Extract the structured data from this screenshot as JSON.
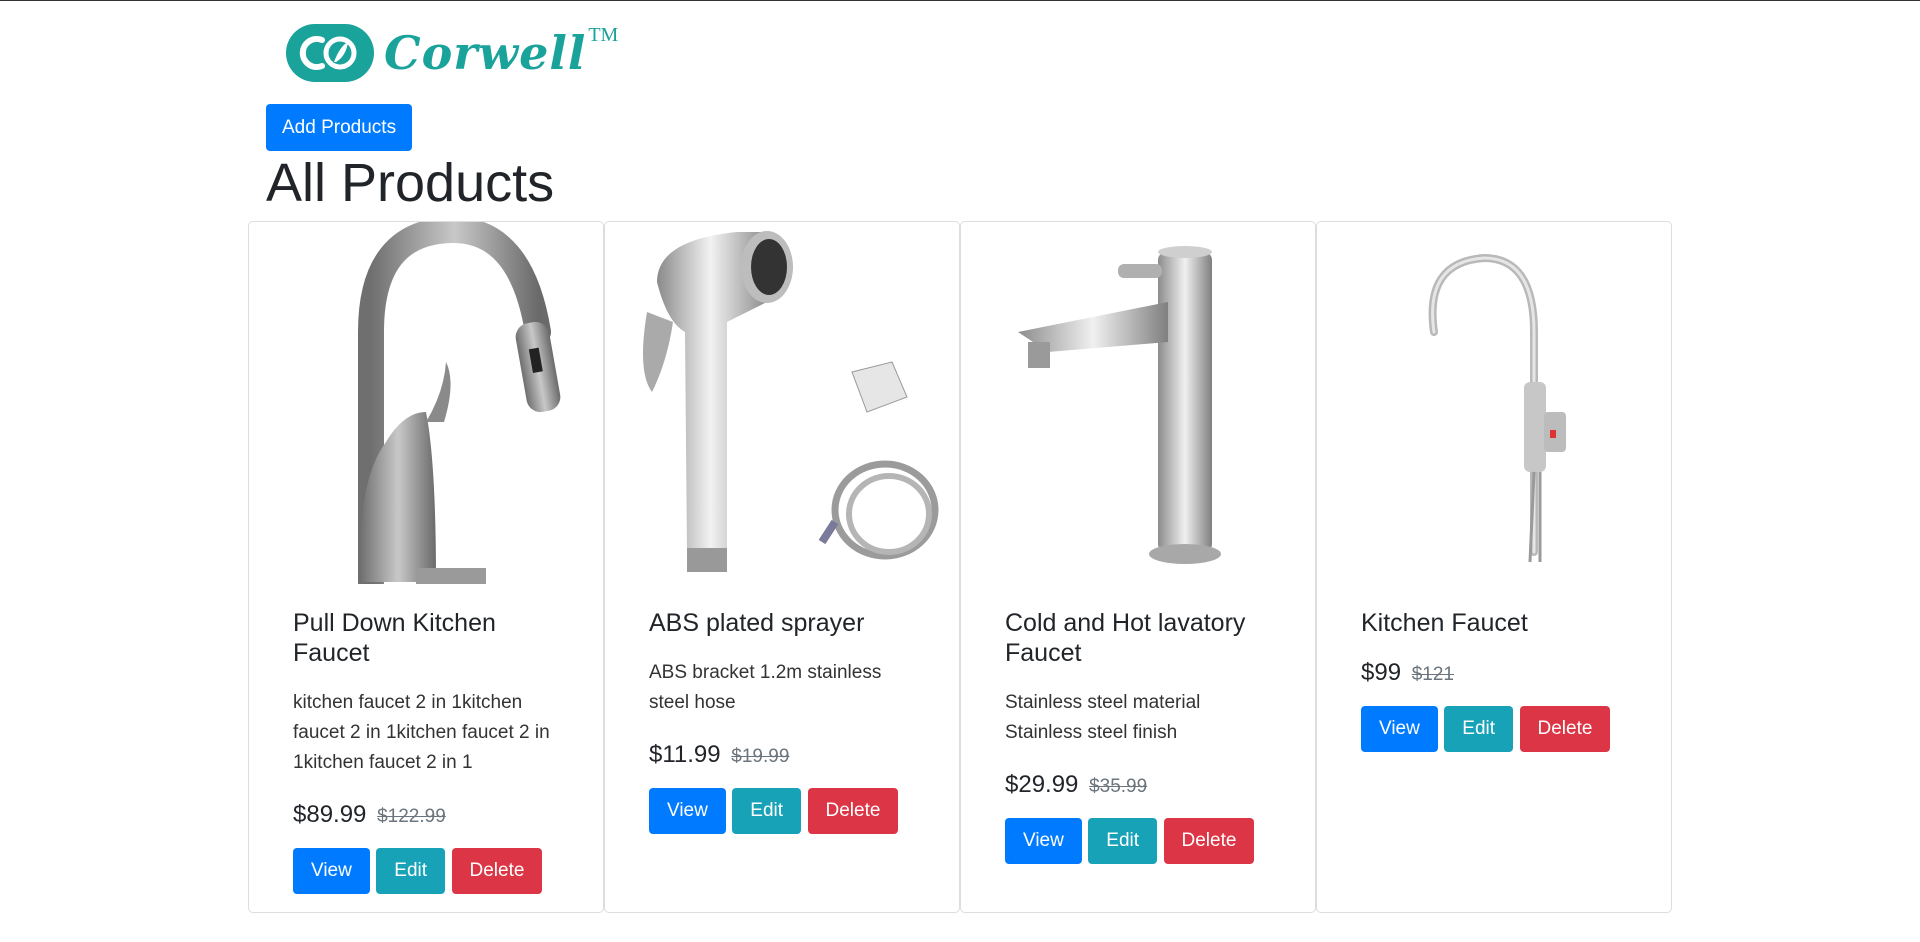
{
  "brand": {
    "name": "Corwell",
    "tm": "TM",
    "color": "#1aa39a"
  },
  "header": {
    "add_button": "Add Products",
    "title": "All Products"
  },
  "products": [
    {
      "title": "Pull Down Kitchen Faucet",
      "description": "kitchen faucet 2 in 1kitchen faucet 2 in 1kitchen faucet 2 in 1kitchen faucet 2 in 1",
      "price": "$89.99",
      "old_price": "$122.99",
      "image": "pull-down-kitchen-faucet-image",
      "view": "View",
      "edit": "Edit",
      "delete": "Delete"
    },
    {
      "title": "ABS plated sprayer",
      "description": "ABS bracket 1.2m stainless steel hose",
      "price": "$11.99",
      "old_price": "$19.99",
      "image": "sprayer-image",
      "view": "View",
      "edit": "Edit",
      "delete": "Delete"
    },
    {
      "title": "Cold and Hot lavatory Faucet",
      "description": "Stainless steel material Stainless steel finish",
      "price": "$29.99",
      "old_price": "$35.99",
      "image": "lavatory-faucet-image",
      "view": "View",
      "edit": "Edit",
      "delete": "Delete"
    },
    {
      "title": "Kitchen Faucet",
      "description": "",
      "price": "$99",
      "old_price": "$121",
      "image": "kitchen-faucet-image",
      "view": "View",
      "edit": "Edit",
      "delete": "Delete"
    }
  ],
  "colors": {
    "primary": "#007bff",
    "info": "#17a2b8",
    "danger": "#dc3545"
  }
}
